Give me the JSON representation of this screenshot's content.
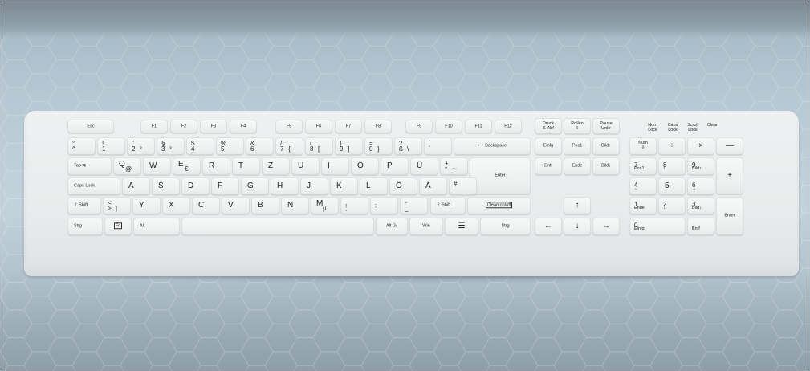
{
  "keyboard": {
    "fn_row": {
      "esc": "Esc",
      "f1": "F1",
      "f2": "F2",
      "f3": "F3",
      "f4": "F4",
      "f5": "F5",
      "f6": "F6",
      "f7": "F7",
      "f8": "F8",
      "f9": "F9",
      "f10": "F10",
      "f11": "F11",
      "f12": "F12",
      "druck": "Druck\nS-Abf",
      "rollen": "Rollen\n⇩",
      "pause": "Pause\nUnbr",
      "num_led": "Num\nLock",
      "caps_led": "Caps\nLock",
      "scroll_led": "Scroll\nLock",
      "clean_led": "Clean"
    },
    "row1": {
      "k1": [
        "^",
        "°"
      ],
      "k2": [
        "1",
        "!"
      ],
      "k3": [
        "2",
        "\"",
        "²"
      ],
      "k4": [
        "3",
        "§",
        "³"
      ],
      "k5": [
        "4",
        "$"
      ],
      "k6": [
        "5",
        "%"
      ],
      "k7": [
        "6",
        "&"
      ],
      "k8": [
        "7",
        "/",
        "{"
      ],
      "k9": [
        "8",
        "(",
        "["
      ],
      "k10": [
        "9",
        ")",
        "]"
      ],
      "k11": [
        "0",
        "=",
        "}"
      ],
      "k12": [
        "ß",
        "?",
        "\\"
      ],
      "k13": [
        "´",
        "`"
      ],
      "backspace": "⟵ Backspace",
      "einfg": "Einfg",
      "pos1": "Pos1",
      "bild_up": "Bild↑",
      "num": "Num\n⇩",
      "div": "÷",
      "mul": "×",
      "minus": "—"
    },
    "row2": {
      "tab": "Tab ⇆",
      "q": [
        "Q",
        "@"
      ],
      "w": "W",
      "e": [
        "E",
        "€"
      ],
      "r": "R",
      "t": "T",
      "z": "Z",
      "u": "U",
      "i": "I",
      "o": "O",
      "p": "P",
      "ue": "Ü",
      "plus": [
        "*",
        "+",
        "~"
      ],
      "enter": "Enter",
      "entf": "Entf",
      "ende": "Ende",
      "bild_down": "Bild↓",
      "n7": [
        "7",
        "Pos1"
      ],
      "n8": [
        "8",
        "↑"
      ],
      "n9": [
        "9",
        "Bild↑"
      ],
      "nplus": "+"
    },
    "row3": {
      "caps": "Caps Lock",
      "a": "A",
      "s": "S",
      "d": "D",
      "f": "F",
      "g": "G",
      "h": "H",
      "j": "J",
      "k": "K",
      "l": "L",
      "oe": "Ö",
      "ae": "Ä",
      "hash": [
        "'",
        "#"
      ],
      "n4": [
        "4",
        "←"
      ],
      "n5": "5",
      "n6": [
        "6",
        "→"
      ]
    },
    "row4": {
      "lshift": "⇧ Shift",
      "lt": [
        ">",
        "<",
        "|"
      ],
      "y": "Y",
      "x": "X",
      "c": "C",
      "v": "V",
      "b": "B",
      "n": "N",
      "m": [
        "M",
        "µ"
      ],
      "comma": [
        ";",
        ","
      ],
      "dot": [
        ":",
        "."
      ],
      "dash": [
        "_",
        "-"
      ],
      "rshift": "⇧ Shift",
      "clean": "Clean on/off",
      "up": "↑",
      "n1": [
        "1",
        "Ende"
      ],
      "n2": [
        "2",
        "↓"
      ],
      "n3": [
        "3",
        "Bild↓"
      ],
      "nenter": "Enter"
    },
    "row5": {
      "strg": "Strg",
      "fn": "Fn",
      "alt": "Alt",
      "altgr": "Alt Gr",
      "win": "Win",
      "menu": "☰",
      "strg_r": "Strg",
      "left": "←",
      "down": "↓",
      "right": "→",
      "n0": [
        "0",
        "Einfg"
      ],
      "ndel": [
        ",",
        "Entf"
      ]
    }
  }
}
